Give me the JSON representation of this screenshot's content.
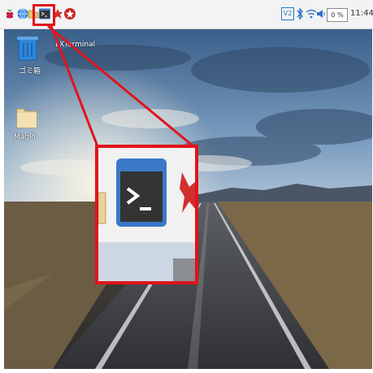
{
  "desktop": {
    "trash_label": "ゴミ箱",
    "folder_label": "MagPi",
    "tooltip": "LXTerminal"
  },
  "taskbar": {
    "icons": [
      "raspberry-menu-icon",
      "browser-globe-icon",
      "file-manager-icon",
      "terminal-icon",
      "math-icon",
      "wolfram-icon"
    ],
    "tray_icons": [
      "vnc-icon",
      "bluetooth-icon",
      "wifi-icon",
      "volume-icon"
    ],
    "vnc_label": "V2",
    "cpu_usage": "0 %",
    "clock": "11:44"
  },
  "colors": {
    "highlight": "#e0141b",
    "panel": "#f3f3f3"
  }
}
